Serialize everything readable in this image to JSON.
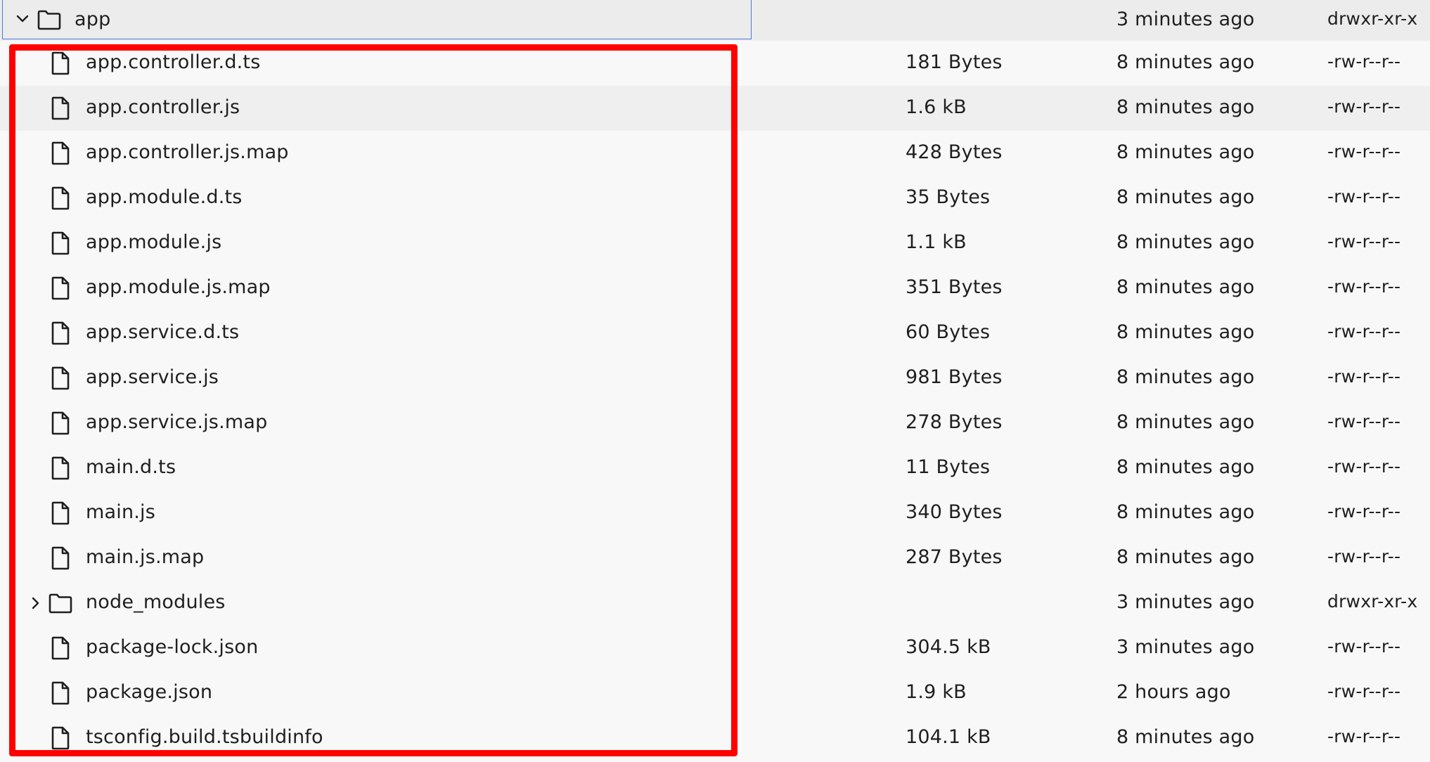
{
  "tree": {
    "parent": {
      "name": "app",
      "modified": "3 minutes ago",
      "permissions": "drwxr-xr-x",
      "icon": "folder-open-icon",
      "expanded": true
    },
    "children": [
      {
        "name": "app.controller.d.ts",
        "size": "181 Bytes",
        "modified": "8 minutes ago",
        "permissions": "-rw-r--r--",
        "type": "file"
      },
      {
        "name": "app.controller.js",
        "size": "1.6 kB",
        "modified": "8 minutes ago",
        "permissions": "-rw-r--r--",
        "type": "file"
      },
      {
        "name": "app.controller.js.map",
        "size": "428 Bytes",
        "modified": "8 minutes ago",
        "permissions": "-rw-r--r--",
        "type": "file"
      },
      {
        "name": "app.module.d.ts",
        "size": "35 Bytes",
        "modified": "8 minutes ago",
        "permissions": "-rw-r--r--",
        "type": "file"
      },
      {
        "name": "app.module.js",
        "size": "1.1 kB",
        "modified": "8 minutes ago",
        "permissions": "-rw-r--r--",
        "type": "file"
      },
      {
        "name": "app.module.js.map",
        "size": "351 Bytes",
        "modified": "8 minutes ago",
        "permissions": "-rw-r--r--",
        "type": "file"
      },
      {
        "name": "app.service.d.ts",
        "size": "60 Bytes",
        "modified": "8 minutes ago",
        "permissions": "-rw-r--r--",
        "type": "file"
      },
      {
        "name": "app.service.js",
        "size": "981 Bytes",
        "modified": "8 minutes ago",
        "permissions": "-rw-r--r--",
        "type": "file"
      },
      {
        "name": "app.service.js.map",
        "size": "278 Bytes",
        "modified": "8 minutes ago",
        "permissions": "-rw-r--r--",
        "type": "file"
      },
      {
        "name": "main.d.ts",
        "size": "11 Bytes",
        "modified": "8 minutes ago",
        "permissions": "-rw-r--r--",
        "type": "file"
      },
      {
        "name": "main.js",
        "size": "340 Bytes",
        "modified": "8 minutes ago",
        "permissions": "-rw-r--r--",
        "type": "file"
      },
      {
        "name": "main.js.map",
        "size": "287 Bytes",
        "modified": "8 minutes ago",
        "permissions": "-rw-r--r--",
        "type": "file"
      },
      {
        "name": "node_modules",
        "size": "",
        "modified": "3 minutes ago",
        "permissions": "drwxr-xr-x",
        "type": "folder"
      },
      {
        "name": "package-lock.json",
        "size": "304.5 kB",
        "modified": "3 minutes ago",
        "permissions": "-rw-r--r--",
        "type": "file"
      },
      {
        "name": "package.json",
        "size": "1.9 kB",
        "modified": "2 hours ago",
        "permissions": "-rw-r--r--",
        "type": "file"
      },
      {
        "name": "tsconfig.build.tsbuildinfo",
        "size": "104.1 kB",
        "modified": "8 minutes ago",
        "permissions": "-rw-r--r--",
        "type": "file"
      }
    ]
  },
  "highlight": {
    "color": "#ff0000"
  },
  "colors": {
    "background": "#f8f8f8",
    "selected_row": "#ececec",
    "hover_row": "#efefef",
    "selection_border": "#4a7bd9",
    "text": "#1f1f1f"
  },
  "icons": {
    "file": "file-icon",
    "folder": "folder-icon",
    "expanded": "chevron-down-icon",
    "collapsed": "chevron-right-icon"
  }
}
